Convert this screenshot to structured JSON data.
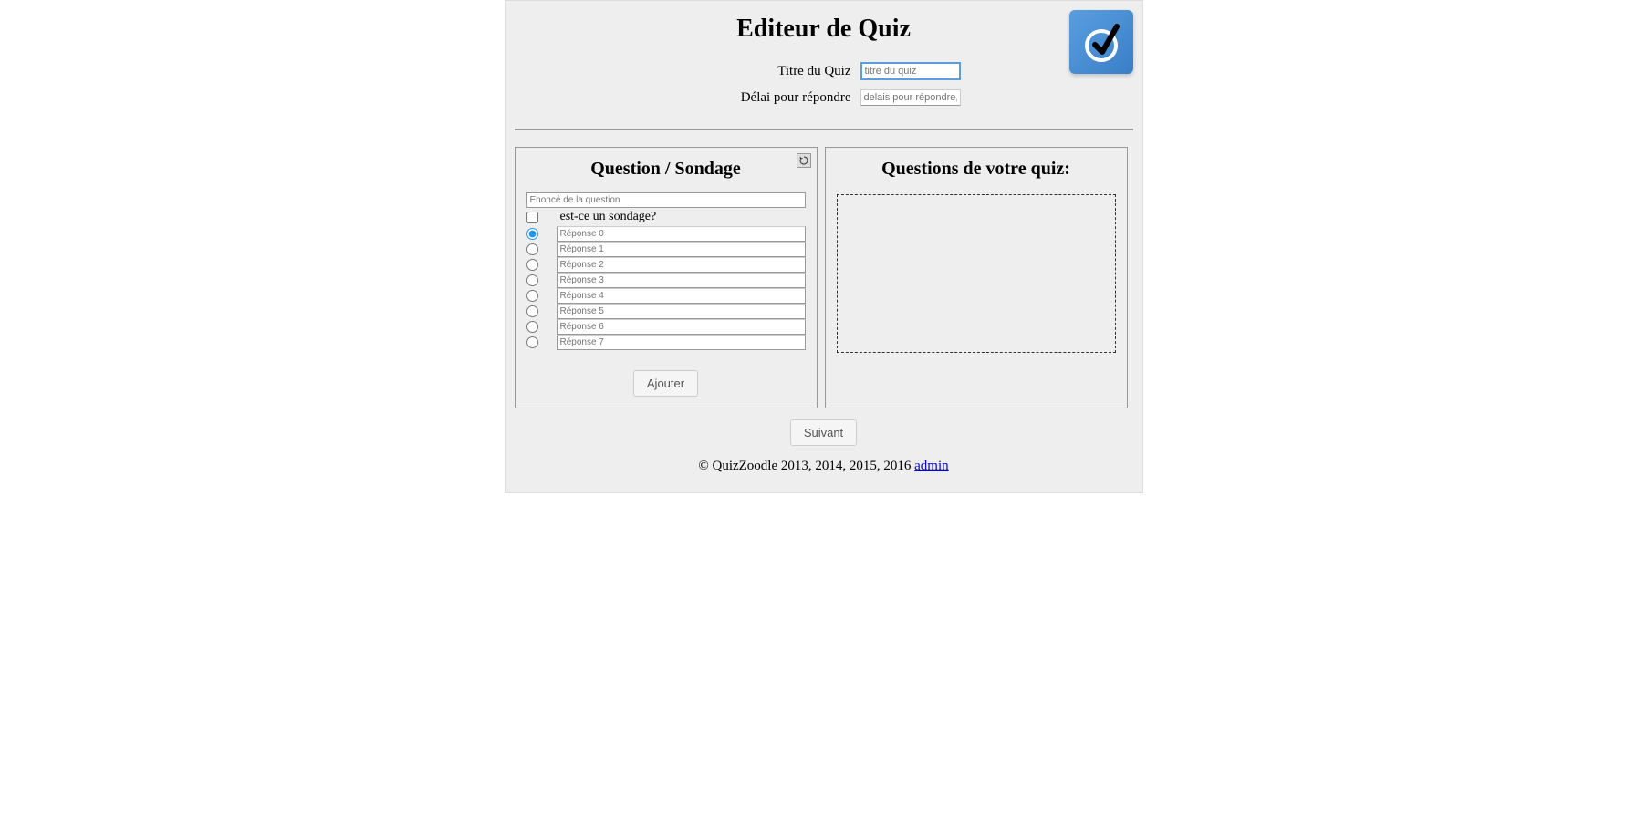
{
  "header": {
    "title": "Editeur de Quiz",
    "quiz_title_label": "Titre du Quiz",
    "quiz_title_placeholder": "titre du quiz",
    "delay_label": "Délai pour répondre",
    "delay_placeholder": "delais pour répondre,"
  },
  "left_panel": {
    "title": "Question / Sondage",
    "question_placeholder": "Enoncé de la question",
    "sondage_label": "est-ce un sondage?",
    "answers": [
      {
        "placeholder": "Réponse 0",
        "checked": true
      },
      {
        "placeholder": "Réponse 1",
        "checked": false
      },
      {
        "placeholder": "Réponse 2",
        "checked": false
      },
      {
        "placeholder": "Réponse 3",
        "checked": false
      },
      {
        "placeholder": "Réponse 4",
        "checked": false
      },
      {
        "placeholder": "Réponse 5",
        "checked": false
      },
      {
        "placeholder": "Réponse 6",
        "checked": false
      },
      {
        "placeholder": "Réponse 7",
        "checked": false
      }
    ],
    "add_button": "Ajouter"
  },
  "right_panel": {
    "title": "Questions de votre quiz:"
  },
  "buttons": {
    "next": "Suivant"
  },
  "footer": {
    "copyright": "© QuizZoodle 2013, 2014, 2015, 2016 ",
    "admin_link": "admin"
  }
}
